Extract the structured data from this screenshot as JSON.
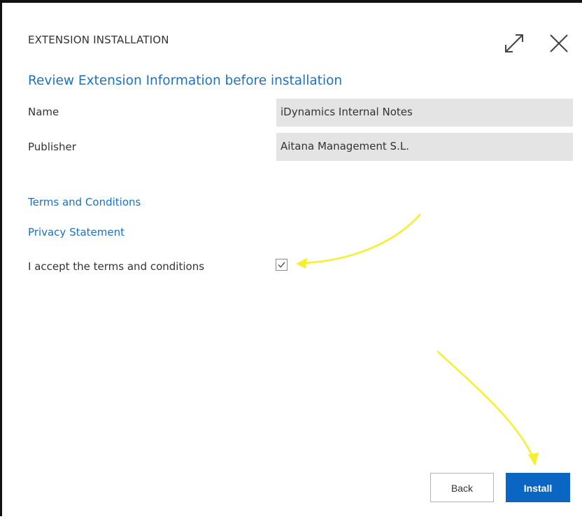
{
  "dialog": {
    "title": "EXTENSION INSTALLATION",
    "subtitle": "Review Extension Information before installation"
  },
  "fields": {
    "name_label": "Name",
    "name_value": "iDynamics Internal Notes",
    "publisher_label": "Publisher",
    "publisher_value": "Aitana Management S.L."
  },
  "links": {
    "terms": "Terms and Conditions",
    "privacy": "Privacy Statement"
  },
  "accept": {
    "label": "I accept the terms and conditions",
    "checked": true
  },
  "buttons": {
    "back": "Back",
    "install": "Install"
  },
  "icons": {
    "expand": "expand-icon",
    "close": "close-icon",
    "check": "checkmark-icon"
  },
  "colors": {
    "accent": "#1a72c4",
    "primary_button": "#0b66c3",
    "field_background": "#e4e4e4",
    "annotation_arrow": "#f7ef2a"
  }
}
